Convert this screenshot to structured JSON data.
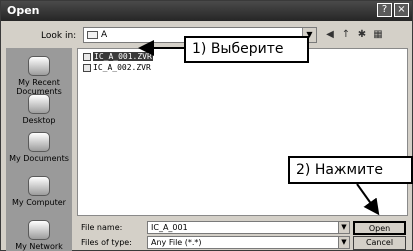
{
  "window": {
    "title": "Open",
    "help_btn": "?",
    "close_btn": "×"
  },
  "look_in": {
    "label": "Look in:",
    "value": "A"
  },
  "places": [
    {
      "label": "My Recent\nDocuments"
    },
    {
      "label": "Desktop"
    },
    {
      "label": "My Documents"
    },
    {
      "label": "My Computer"
    },
    {
      "label": "My Network"
    }
  ],
  "files": [
    {
      "name": "IC_A_001.ZVR",
      "selected": true
    },
    {
      "name": "IC_A_002.ZVR",
      "selected": false
    }
  ],
  "file_name": {
    "label": "File name:",
    "value": "IC_A_001"
  },
  "file_type": {
    "label": "Files of type:",
    "value": "Any File (*.*)"
  },
  "buttons": {
    "open": "Open",
    "cancel": "Cancel"
  },
  "annotations": {
    "select": "1) Выберите",
    "press": "2) Нажмите"
  }
}
